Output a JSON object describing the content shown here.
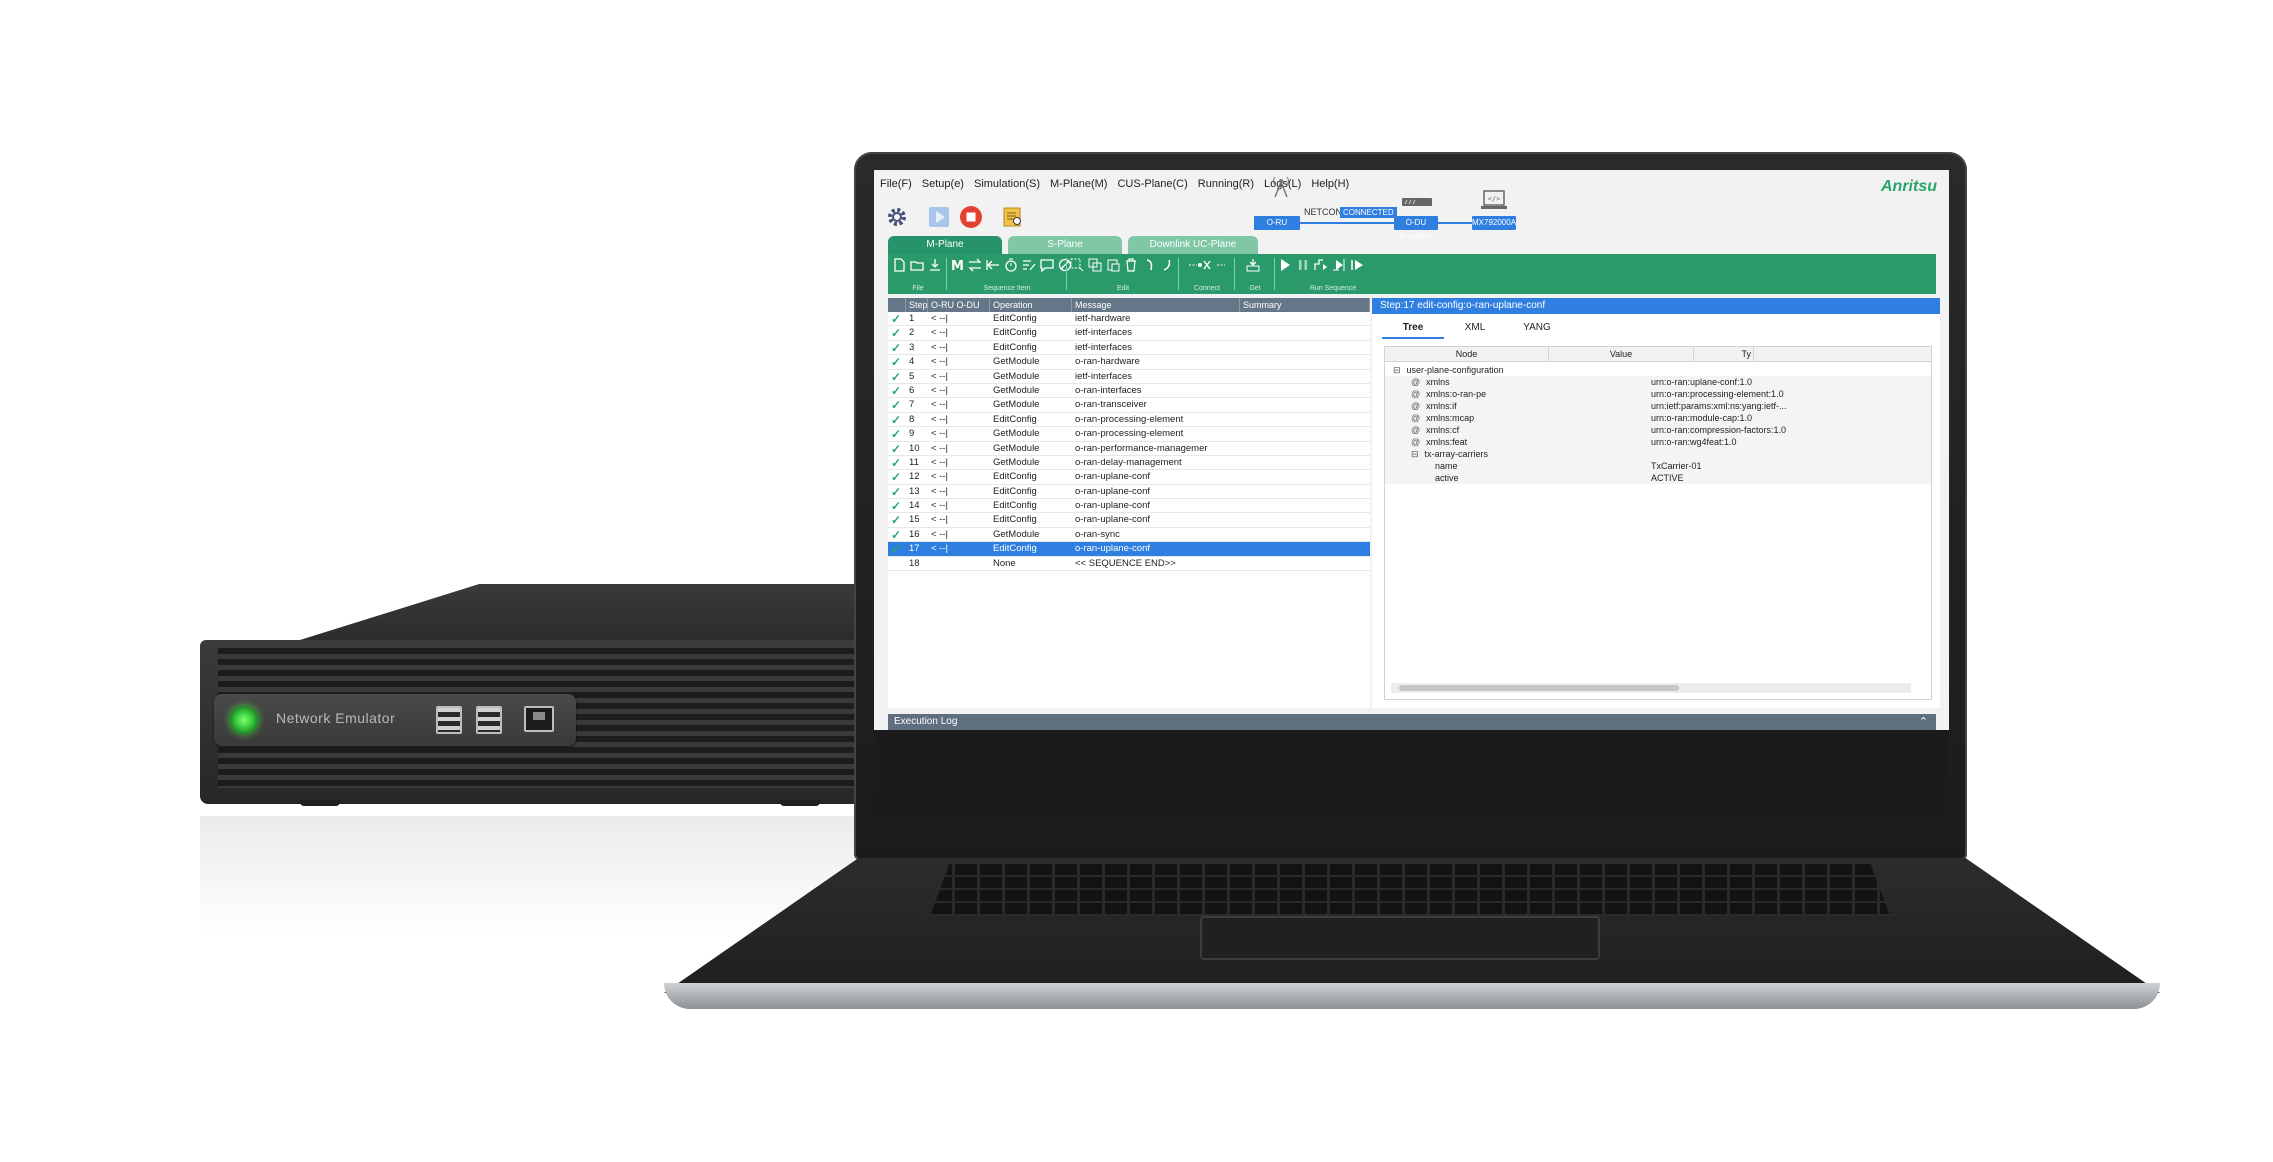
{
  "device": {
    "label": "Network Emulator"
  },
  "app": {
    "menu": [
      "File(F)",
      "Setup(e)",
      "Simulation(S)",
      "M-Plane(M)",
      "CUS-Plane(C)",
      "Running(R)",
      "Logs(L)",
      "Help(H)"
    ],
    "brand": "Anritsu",
    "status": {
      "oru": "O-RU",
      "netconf": "NETCONF",
      "connected": "CONNECTED",
      "odu": "O-DU Emulator",
      "controller": "MX792000A"
    },
    "tabs": [
      {
        "label": "M-Plane",
        "active": true
      },
      {
        "label": "S-Plane",
        "active": false
      },
      {
        "label": "Downlink UC-Plane",
        "active": false
      }
    ],
    "ribbon_groups": [
      "File",
      "Sequence Item",
      "Edit",
      "Connect",
      "Get",
      "Run Sequence"
    ],
    "sequence": {
      "columns": [
        "Step",
        "O-RU O-DU",
        "Operation",
        "Message",
        "Summary"
      ],
      "rows": [
        {
          "step": "1",
          "dir": "< --|",
          "op": "EditConfig",
          "msg": "ietf-hardware",
          "done": true
        },
        {
          "step": "2",
          "dir": "< --|",
          "op": "EditConfig",
          "msg": "ietf-interfaces",
          "done": true
        },
        {
          "step": "3",
          "dir": "< --|",
          "op": "EditConfig",
          "msg": "ietf-interfaces",
          "done": true
        },
        {
          "step": "4",
          "dir": "< --|",
          "op": "GetModule",
          "msg": "o-ran-hardware",
          "done": true
        },
        {
          "step": "5",
          "dir": "< --|",
          "op": "GetModule",
          "msg": "ietf-interfaces",
          "done": true
        },
        {
          "step": "6",
          "dir": "< --|",
          "op": "GetModule",
          "msg": "o-ran-interfaces",
          "done": true
        },
        {
          "step": "7",
          "dir": "< --|",
          "op": "GetModule",
          "msg": "o-ran-transceiver",
          "done": true
        },
        {
          "step": "8",
          "dir": "< --|",
          "op": "EditConfig",
          "msg": "o-ran-processing-element",
          "done": true
        },
        {
          "step": "9",
          "dir": "< --|",
          "op": "GetModule",
          "msg": "o-ran-processing-element",
          "done": true
        },
        {
          "step": "10",
          "dir": "< --|",
          "op": "GetModule",
          "msg": "o-ran-performance-managemer",
          "done": true
        },
        {
          "step": "11",
          "dir": "< --|",
          "op": "GetModule",
          "msg": "o-ran-delay-management",
          "done": true
        },
        {
          "step": "12",
          "dir": "< --|",
          "op": "EditConfig",
          "msg": "o-ran-uplane-conf",
          "done": true
        },
        {
          "step": "13",
          "dir": "< --|",
          "op": "EditConfig",
          "msg": "o-ran-uplane-conf",
          "done": true
        },
        {
          "step": "14",
          "dir": "< --|",
          "op": "EditConfig",
          "msg": "o-ran-uplane-conf",
          "done": true
        },
        {
          "step": "15",
          "dir": "< --|",
          "op": "EditConfig",
          "msg": "o-ran-uplane-conf",
          "done": true
        },
        {
          "step": "16",
          "dir": "< --|",
          "op": "GetModule",
          "msg": "o-ran-sync",
          "done": true
        },
        {
          "step": "17",
          "dir": "< --|",
          "op": "EditConfig",
          "msg": "o-ran-uplane-conf",
          "done": true,
          "selected": true
        },
        {
          "step": "18",
          "dir": "",
          "op": "None",
          "msg": "<< SEQUENCE END>>",
          "done": false
        }
      ]
    },
    "detail": {
      "title": "Step:17  edit-config:o-ran-uplane-conf",
      "tabs": [
        "Tree",
        "XML",
        "YANG"
      ],
      "tree_columns": [
        "Node",
        "Value",
        "Ty"
      ],
      "tree": [
        {
          "node": "user-plane-configuration",
          "value": "",
          "prefix": "⊟",
          "indent": 1
        },
        {
          "node": "xmlns",
          "value": "urn:o-ran:uplane-conf:1.0",
          "prefix": "@",
          "indent": 2
        },
        {
          "node": "xmlns:o-ran-pe",
          "value": "urn:o-ran:processing-element:1.0",
          "prefix": "@",
          "indent": 2
        },
        {
          "node": "xmlns:if",
          "value": "urn:ietf:params:xml:ns:yang:ietf-...",
          "prefix": "@",
          "indent": 2
        },
        {
          "node": "xmlns:mcap",
          "value": "urn:o-ran:module-cap:1.0",
          "prefix": "@",
          "indent": 2
        },
        {
          "node": "xmlns:cf",
          "value": "urn:o-ran:compression-factors:1.0",
          "prefix": "@",
          "indent": 2
        },
        {
          "node": "xmlns:feat",
          "value": "urn:o-ran:wg4feat:1.0",
          "prefix": "@",
          "indent": 2
        },
        {
          "node": "tx-array-carriers",
          "value": "",
          "prefix": "⊟",
          "indent": 2
        },
        {
          "node": "name",
          "value": "TxCarrier-01",
          "prefix": "",
          "indent": 3
        },
        {
          "node": "active",
          "value": "ACTIVE",
          "prefix": "",
          "indent": 3
        }
      ]
    },
    "execution_log": {
      "label": "Execution Log"
    }
  }
}
